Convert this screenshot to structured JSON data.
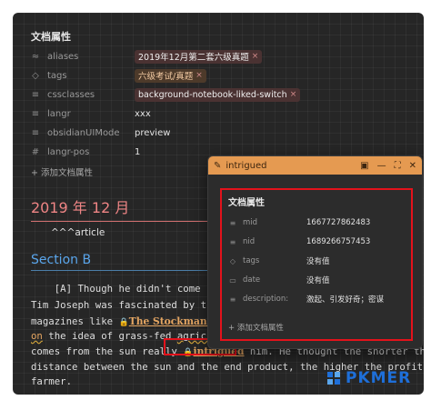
{
  "properties": {
    "heading": "文档属性",
    "rows": [
      {
        "icon": "≈",
        "key": "aliases",
        "pills": [
          "2019年12月第二套六级真题"
        ],
        "tag": false
      },
      {
        "icon": "◇",
        "key": "tags",
        "pills": [
          "六级考试/真题"
        ],
        "tag": true
      },
      {
        "icon": "≡",
        "key": "cssclasses",
        "pills": [
          "background-notebook-liked-switch"
        ],
        "tag": false
      },
      {
        "icon": "≡",
        "key": "langr",
        "value": "xxx"
      },
      {
        "icon": "≡",
        "key": "obsidianUIMode",
        "value": "preview"
      },
      {
        "icon": "#",
        "key": "langr-pos",
        "value": "1"
      }
    ],
    "add_label": "+ 添加文档属性",
    "remove_glyph": "×"
  },
  "content": {
    "h1": "2019 年 12 月",
    "article": "^^^article",
    "h2": "Section B",
    "lines": {
      "l1": "    [A] Though he didn't come from",
      "l2": "Tim Joseph was fascinated by the id",
      "l3_a": "magazines like ",
      "l3_link": "The Stockman Gras",
      "l4_a": "on",
      "l4_b": " the idea of grass-fed ",
      "l4_c": "agriculture",
      "l5_a": "comes from the sun really ",
      "l5_link": "intrigued",
      "l5_b": " him. He thought the shorter the",
      "l6": "distance between the sun and the end product, the higher the profit to the",
      "l7": "farmer."
    },
    "link_glyph": "🔒"
  },
  "popover": {
    "title": "intrigued",
    "icons": {
      "pin": "pin-icon",
      "open": "open-in-new-icon",
      "maximize": "maximize-icon",
      "close": "close-icon"
    },
    "heading": "文档属性",
    "rows": [
      {
        "icon": "≡",
        "key": "mid",
        "value": "1667727862483"
      },
      {
        "icon": "≡",
        "key": "nid",
        "value": "1689266757453"
      },
      {
        "icon": "◇",
        "key": "tags",
        "value": "没有值"
      },
      {
        "icon": "▭",
        "key": "date",
        "value": "没有值"
      },
      {
        "icon": "≡",
        "key": "description:",
        "value": "激起、引发好奇；密谋"
      }
    ],
    "add_label": "+ 添加文档属性"
  },
  "watermark": {
    "text": "PKMER"
  },
  "colors": {
    "accent_header": "#e59a51",
    "highlight_box": "#e3121b",
    "h1": "#ef8585",
    "h2": "#5aa6ec"
  }
}
